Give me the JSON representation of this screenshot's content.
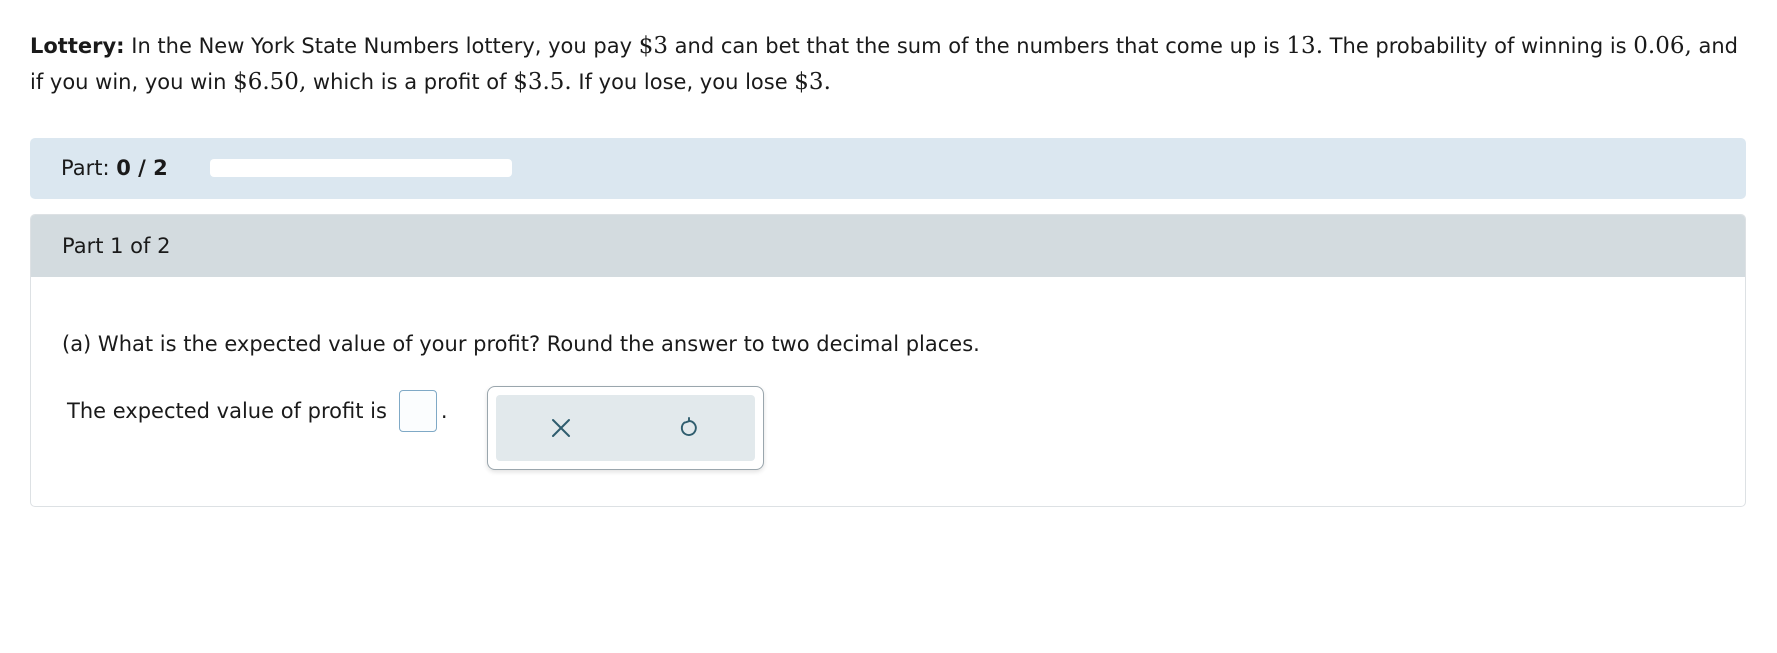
{
  "problem": {
    "label": "Lottery:",
    "t1": " In the New York State Numbers lottery, you pay ",
    "m1": "$3",
    "t2": " and can bet that the sum of the numbers that come up is ",
    "m2": "13.",
    "t3": " The probability of winning is ",
    "m3": "0.06,",
    "t4": " and if you win, you win ",
    "m4": "$6.50,",
    "t5": " which is a profit of ",
    "m5": "$3.5.",
    "t6": " If you lose, you lose ",
    "m6": "$3."
  },
  "progress": {
    "label": "Part: ",
    "value_text": "0 / 2",
    "fraction": 0.0
  },
  "part": {
    "header": "Part 1 of 2",
    "question": "(a) What is the expected value of your profit? Round the answer to two decimal places.",
    "answer_prefix": "The expected value of profit is",
    "answer_value": "",
    "answer_suffix": "."
  },
  "tools": {
    "clear_icon": "close-icon",
    "undo_icon": "undo-icon"
  },
  "colors": {
    "progress_bg": "#dbe7f0",
    "header_bg": "#d3dbdf",
    "icon": "#2f5d6e"
  }
}
